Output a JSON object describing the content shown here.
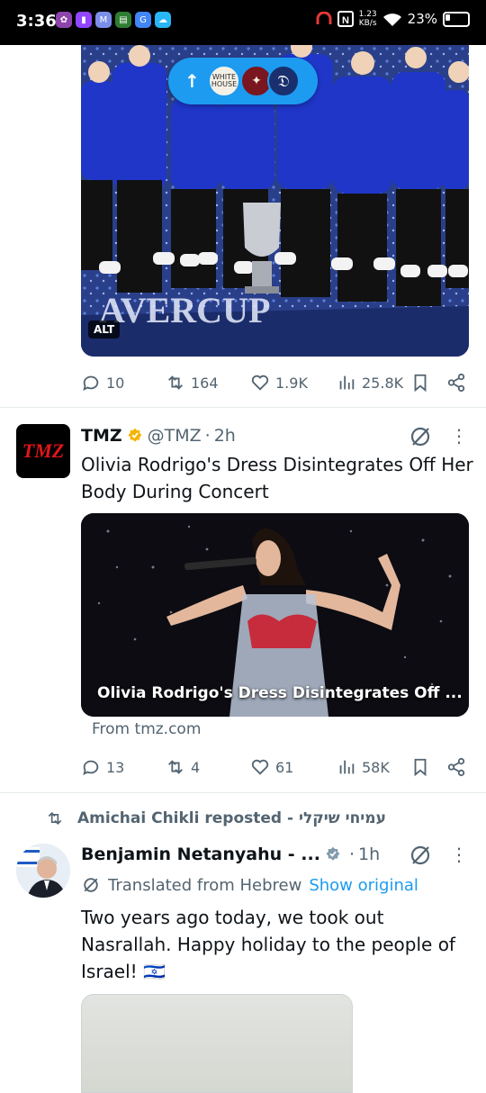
{
  "status_bar": {
    "time": "3:36",
    "net_speed_value": "1.23",
    "net_speed_unit": "KB/s",
    "battery": "23%"
  },
  "tweet1": {
    "media_alt_badge": "ALT",
    "new_posts_pill": {
      "arrow": "↑",
      "avatar1_text": "WHITE HOUSE"
    },
    "actions": {
      "replies": "10",
      "reposts": "164",
      "likes": "1.9K",
      "views": "25.8K"
    }
  },
  "tweet2": {
    "avatar_text": "TMZ",
    "name": "TMZ",
    "handle": "@TMZ",
    "separator": "·",
    "time": "2h",
    "text": "Olivia Rodrigo's Dress Disintegrates Off Her Body During Concert",
    "card_title": "Olivia Rodrigo's Dress Disintegrates Off ...",
    "card_source": "From tmz.com",
    "actions": {
      "replies": "13",
      "reposts": "4",
      "likes": "61",
      "views": "58K"
    },
    "more": "⋮"
  },
  "tweet3": {
    "repost_label": "Amichai Chikli reposted - עמיחי שיקלי",
    "name": "Benjamin Netanyahu - ...",
    "separator": "·",
    "time": "1h",
    "translated_label": "Translated from Hebrew",
    "show_original": "Show original",
    "text": "Two years ago today, we took out Nasrallah. Happy holiday to the people of Israel! 🇮🇱",
    "more": "⋮"
  },
  "colors": {
    "accent": "#1d9bf0",
    "muted": "#536471",
    "text": "#0f1419",
    "verified_gold": "#f4b400",
    "verified_gray": "#829aab"
  }
}
